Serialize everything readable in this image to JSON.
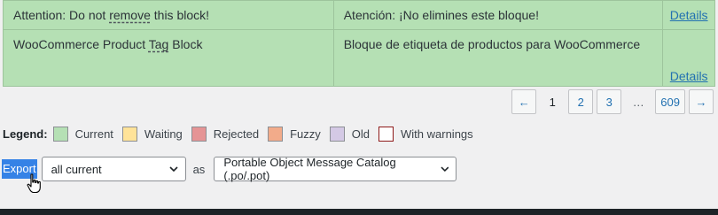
{
  "table": {
    "rows": [
      {
        "original_pre": "Attention: Do not ",
        "original_mark": "remove",
        "original_post": " this block!",
        "translation": "Atención: ¡No elimines este bloque!",
        "link": "Details"
      },
      {
        "original_pre": "WooCommerce Product ",
        "original_mark": "Tag",
        "original_post": " Block",
        "translation": "Bloque de etiqueta de productos para WooCommerce",
        "link": "Details"
      }
    ]
  },
  "pagination": {
    "prev": "←",
    "current": "1",
    "pages": [
      "2",
      "3"
    ],
    "ellipsis": "…",
    "last": "609",
    "next": "→"
  },
  "legend": {
    "label": "Legend:",
    "items": [
      {
        "label": "Current",
        "color": "#b5e0b4"
      },
      {
        "label": "Waiting",
        "color": "#ffe399"
      },
      {
        "label": "Rejected",
        "color": "#e59495"
      },
      {
        "label": "Fuzzy",
        "color": "#f2ab8a"
      },
      {
        "label": "Old",
        "color": "#d4c9e5"
      },
      {
        "label": "With warnings",
        "color": "#ffffff",
        "border": "#8e1919"
      }
    ]
  },
  "export": {
    "button_label": "Export",
    "filter_value": "all current",
    "as_label": "as",
    "format_value": "Portable Object Message Catalog (.po/.pot)"
  },
  "icons": {
    "chevron": "chevron-down-icon",
    "cursor": "hand-pointer-icon"
  }
}
